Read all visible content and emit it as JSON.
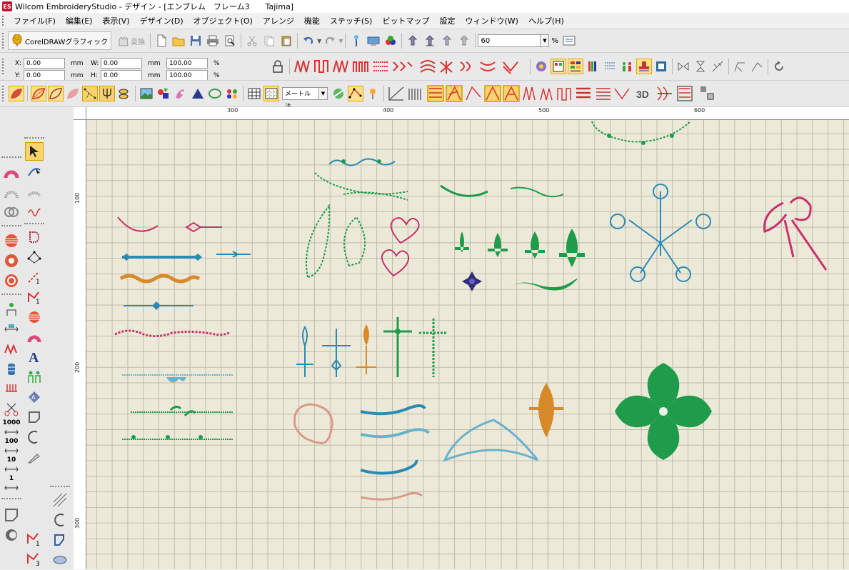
{
  "window": {
    "title": "Wilcom EmbroideryStudio - デザイン - [エンブレム　フレーム3　　Tajima]",
    "app_icon_text": "ES"
  },
  "menu": [
    "ファイル(F)",
    "編集(E)",
    "表示(V)",
    "デザイン(D)",
    "オブジェクト(O)",
    "アレンジ",
    "機能",
    "ステッチ(S)",
    "ビットマップ",
    "設定",
    "ウィンドウ(W)",
    "ヘルプ(H)"
  ],
  "toolbar1": {
    "coreldraw_label": "CorelDRAWグラフィック",
    "convert_label": "変換",
    "zoom_value": "60",
    "zoom_unit": "%"
  },
  "coords": {
    "x_label": "X:",
    "x_value": "0.00",
    "y_label": "Y:",
    "y_value": "0.00",
    "w_label": "W:",
    "w_value": "0.00",
    "h_label": "H:",
    "h_value": "0.00",
    "unit": "mm",
    "scale_w": "100.00",
    "scale_h": "100.00",
    "pct": "%"
  },
  "toolbar3": {
    "method_select": "メートル法",
    "three_d_label": "3D"
  },
  "ruler": {
    "h_ticks": [
      "300",
      "400",
      "500",
      "600"
    ],
    "v_ticks": [
      "100",
      "200",
      "300"
    ]
  },
  "left_tools": {
    "num_1000": "1000",
    "num_100": "100",
    "num_10": "10",
    "num_1": "1",
    "num_1b": "1",
    "num_1c": "1",
    "num_3": "3"
  },
  "colors": {
    "accent": "#fbd36b",
    "grid_bg": "#ece9d8",
    "teal": "#2a8bb5",
    "green": "#1e9c4a",
    "pink": "#c8326e",
    "orange": "#d88a2a",
    "salmon": "#d99a8a",
    "lightblue": "#6ab2cc",
    "navy": "#2e2e7a"
  }
}
